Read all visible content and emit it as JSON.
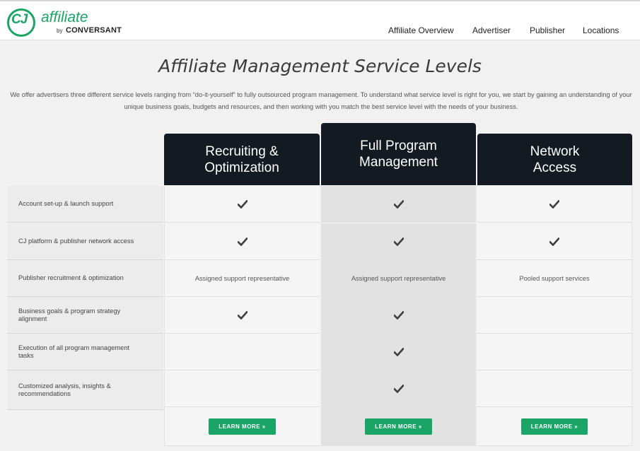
{
  "header": {
    "logo": {
      "mark": "CJ",
      "name": "affiliate",
      "by": "by",
      "brand": "CONVERSANT"
    },
    "nav": [
      "Affiliate Overview",
      "Advertiser",
      "Publisher",
      "Locations"
    ]
  },
  "main": {
    "title": "Affiliate Management Service Levels",
    "intro": "We offer advertisers three different service levels ranging from “do-it-yourself” to fully outsourced program management. To understand what service level is right for you, we start by gaining an understanding of your unique business goals, budgets and resources, and then working with you match the best service level with the needs of your business.",
    "columns": [
      {
        "line1": "Recruiting &",
        "line2": "Optimization"
      },
      {
        "line1": "Full Program",
        "line2": "Management"
      },
      {
        "line1": "Network",
        "line2": "Access"
      }
    ],
    "rows": [
      {
        "label": "Account set-up & launch support",
        "cells": [
          "check",
          "check",
          "check"
        ]
      },
      {
        "label": "CJ platform & publisher network access",
        "cells": [
          "check",
          "check",
          "check"
        ]
      },
      {
        "label": "Publisher recruitment & optimization",
        "cells": [
          "Assigned support representative",
          "Assigned support representative",
          "Pooled support services"
        ]
      },
      {
        "label": "Business goals & program strategy alignment",
        "cells": [
          "check",
          "check",
          ""
        ]
      },
      {
        "label": "Execution of all program management tasks",
        "cells": [
          "",
          "check",
          ""
        ]
      },
      {
        "label": "Customized analysis, insights & recommendations",
        "cells": [
          "",
          "check",
          ""
        ]
      }
    ],
    "button_label": "LEARN MORE »"
  },
  "colors": {
    "brand_green": "#1aa567",
    "header_dark": "#141a22"
  },
  "icons": {
    "check": "checkmark-icon"
  }
}
